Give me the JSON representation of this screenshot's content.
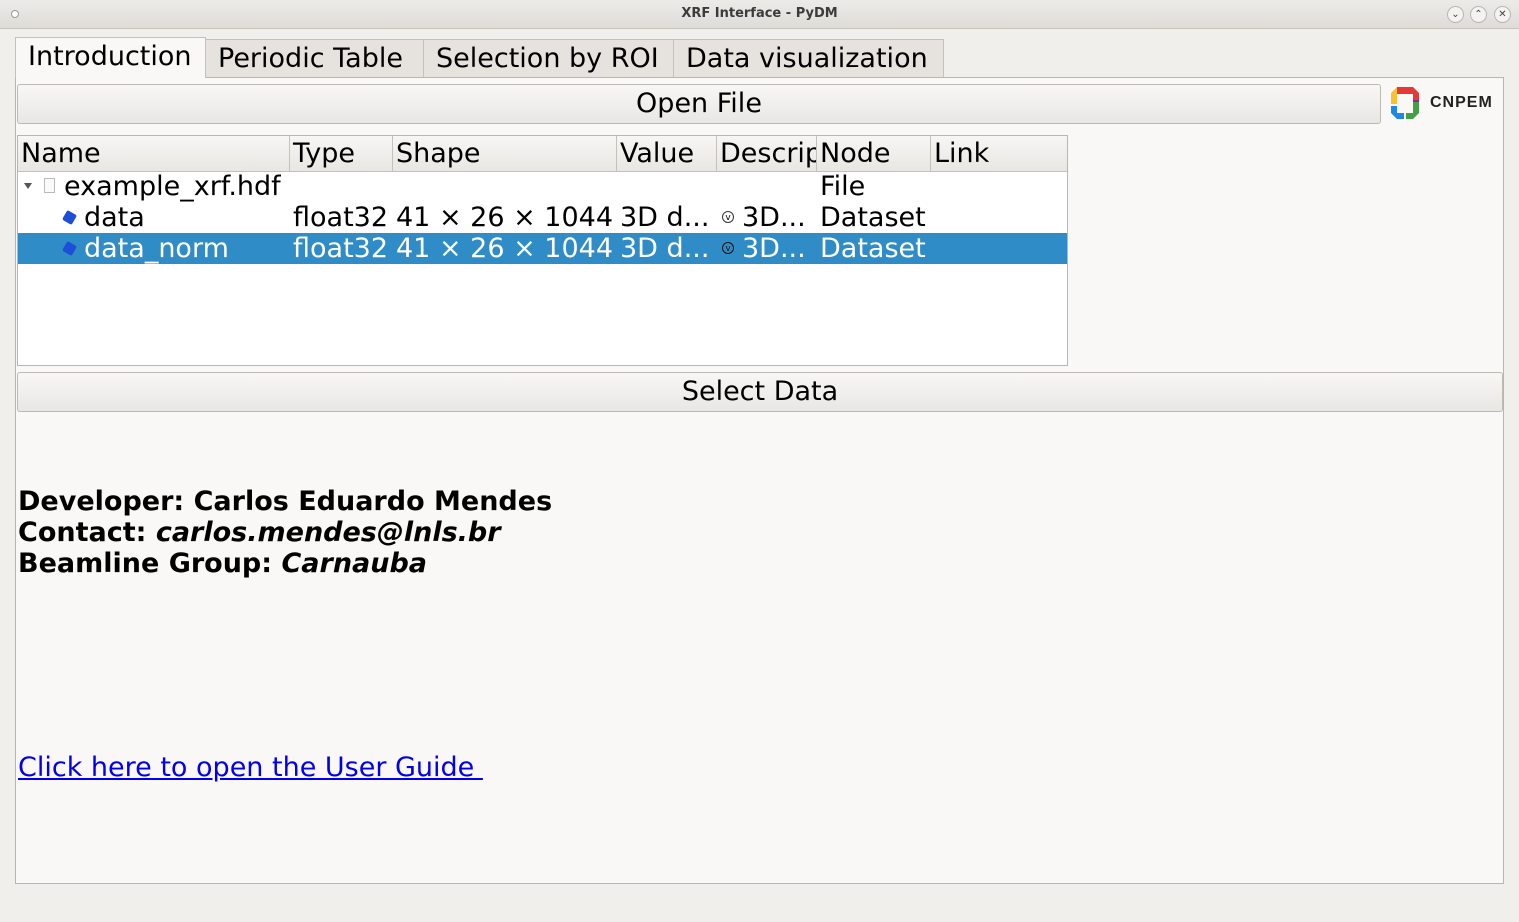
{
  "window": {
    "title": "XRF Interface - PyDM",
    "buttons": [
      "minimize",
      "maximize",
      "close"
    ]
  },
  "tabs": [
    {
      "label": "Introduction",
      "active": true
    },
    {
      "label": "Periodic Table",
      "active": false
    },
    {
      "label": "Selection by ROI",
      "active": false
    },
    {
      "label": "Data visualization",
      "active": false
    }
  ],
  "open_file_button": "Open File",
  "logo": {
    "text": "CNPEM"
  },
  "tree": {
    "columns": [
      "Name",
      "Type",
      "Shape",
      "Value",
      "Descrip",
      "Node",
      "Link"
    ],
    "rows": [
      {
        "name": "example_xrf.hdf",
        "type": "",
        "shape": "",
        "value": "",
        "description": "",
        "node": "File",
        "link": ""
      },
      {
        "name": "data",
        "type": "float32",
        "shape": "41 × 26 × 1044",
        "value": "3D d...",
        "description": "3D...",
        "node": "Dataset",
        "link": ""
      },
      {
        "name": "data_norm",
        "type": "float32",
        "shape": "41 × 26 × 1044",
        "value": "3D d...",
        "description": "3D...",
        "node": "Dataset",
        "link": ""
      }
    ],
    "selected_row": "data_norm"
  },
  "select_data_button": "Select Data",
  "info": {
    "developer_label": "Developer: ",
    "developer": "Carlos Eduardo Mendes",
    "contact_label": "Contact: ",
    "contact": "carlos.mendes@lnls.br",
    "group_label": "Beamline Group: ",
    "group": "Carnauba"
  },
  "user_guide_link": "Click here to open the User Guide "
}
